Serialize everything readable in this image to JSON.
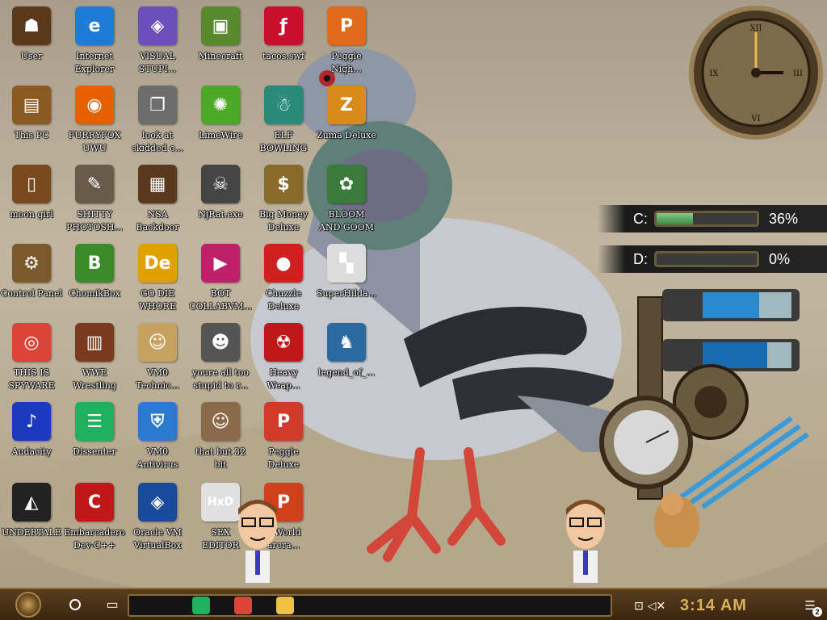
{
  "desktop": {
    "icons": [
      {
        "label": "User",
        "glyph": "☗",
        "color": "#5a3a1c",
        "icon": "user-icon"
      },
      {
        "label": "Internet\nExplorer",
        "glyph": "e",
        "color": "#1e7bd6",
        "icon": "edge-icon"
      },
      {
        "label": "VISUAL\nSTUPI...",
        "glyph": "◈",
        "color": "#6b4fbb",
        "icon": "visual-studio-icon"
      },
      {
        "label": "Minecraft",
        "glyph": "▣",
        "color": "#5b8a2e",
        "icon": "minecraft-icon"
      },
      {
        "label": "tacos.swf",
        "glyph": "ƒ",
        "color": "#c8102e",
        "icon": "flash-file-icon"
      },
      {
        "label": "Peggle\nNigh...",
        "glyph": "P",
        "color": "#e06a1b",
        "icon": "peggle-icon"
      },
      {
        "label": "This PC",
        "glyph": "▤",
        "color": "#8a5a20",
        "icon": "computer-icon"
      },
      {
        "label": "FURRYFOX\nUWU",
        "glyph": "◉",
        "color": "#e66000",
        "icon": "firefox-icon"
      },
      {
        "label": "look at\nskidded c...",
        "glyph": "❐",
        "color": "#6d6d6d",
        "icon": "folder-stack-icon"
      },
      {
        "label": "LimeWire",
        "glyph": "✺",
        "color": "#4ea828",
        "icon": "limewire-icon"
      },
      {
        "label": "ELF\nBOWLING",
        "glyph": "☃",
        "color": "#2a8a7a",
        "icon": "elf-bowling-icon"
      },
      {
        "label": "Zuma Deluxe",
        "glyph": "Z",
        "color": "#d88a1a",
        "icon": "zuma-icon"
      },
      {
        "label": "moon girl",
        "glyph": "▯",
        "color": "#7a4a1e",
        "icon": "file-icon"
      },
      {
        "label": "SHITTY\nPHOTOSH...",
        "glyph": "✎",
        "color": "#6a5a4a",
        "icon": "gimp-icon"
      },
      {
        "label": "NSA\nBackdoor",
        "glyph": "▦",
        "color": "#5a3a1e",
        "icon": "backdoor-icon"
      },
      {
        "label": "NjRat.exe",
        "glyph": "☠",
        "color": "#444444",
        "icon": "skull-icon"
      },
      {
        "label": "Big Money\nDeluxe",
        "glyph": "$",
        "color": "#8a6a2a",
        "icon": "money-bag-icon"
      },
      {
        "label": "BLOOM\nAND GOOM",
        "glyph": "✿",
        "color": "#3a7a3a",
        "icon": "flower-icon"
      },
      {
        "label": "Control Panel",
        "glyph": "⚙",
        "color": "#7a5a2a",
        "icon": "control-panel-icon"
      },
      {
        "label": "ChomikBox",
        "glyph": "B",
        "color": "#3a8a2a",
        "icon": "chomikbox-icon"
      },
      {
        "label": "GO DIE\nWHORE",
        "glyph": "De",
        "color": "#e0a000",
        "icon": "dev-app-icon"
      },
      {
        "label": "BOT\nCOLLABVM...",
        "glyph": "▶",
        "color": "#c0206a",
        "icon": "bot-icon"
      },
      {
        "label": "Chuzzle\nDeluxe",
        "glyph": "●",
        "color": "#d02020",
        "icon": "chuzzle-icon"
      },
      {
        "label": "SuperHilda...",
        "glyph": "▚",
        "color": "#dcdcdc",
        "icon": "pixel-game-icon"
      },
      {
        "label": "THIS IS\nSPYWARE",
        "glyph": "◎",
        "color": "#db4437",
        "icon": "chrome-icon"
      },
      {
        "label": "WWE\nWrestling",
        "glyph": "▥",
        "color": "#7a3a1e",
        "icon": "wrestling-icon"
      },
      {
        "label": "VM0\nTechnic...",
        "glyph": "☺",
        "color": "#c8a060",
        "icon": "technician-icon"
      },
      {
        "label": "youre all too\nstupid to r...",
        "glyph": "☻",
        "color": "#555555",
        "icon": "portrait-icon"
      },
      {
        "label": "Heavy\nWeap...",
        "glyph": "☢",
        "color": "#c01818",
        "icon": "radiation-icon"
      },
      {
        "label": "legend_of_...",
        "glyph": "♞",
        "color": "#2a6aa0",
        "icon": "legend-game-icon"
      },
      {
        "label": "Audacity",
        "glyph": "♪",
        "color": "#1a3ac0",
        "icon": "audacity-icon"
      },
      {
        "label": "Dissenter",
        "glyph": "☰",
        "color": "#20b060",
        "icon": "dissenter-icon"
      },
      {
        "label": "VM0\nAntivirus",
        "glyph": "⛨",
        "color": "#2a7ad0",
        "icon": "shield-icon"
      },
      {
        "label": "that but 32\nbit",
        "glyph": "☺",
        "color": "#8a6a4a",
        "icon": "portrait-icon"
      },
      {
        "label": "Peggle\nDeluxe",
        "glyph": "P",
        "color": "#d03a2a",
        "icon": "peggle-icon"
      },
      {
        "label": "",
        "glyph": "",
        "color": "transparent",
        "icon": "empty-slot"
      },
      {
        "label": "UNDERTALE",
        "glyph": "◭",
        "color": "#222222",
        "icon": "unity-icon"
      },
      {
        "label": "Embarcadero\nDev-C++",
        "glyph": "C",
        "color": "#c01818",
        "icon": "devcpp-icon"
      },
      {
        "label": "Oracle VM\nVirtualBox",
        "glyph": "◈",
        "color": "#1a4a9a",
        "icon": "virtualbox-icon"
      },
      {
        "label": "SEX\nEDITOR",
        "glyph": "HxD",
        "color": "#e0e0e0",
        "icon": "hex-editor-icon"
      },
      {
        "label": "e World\narcra...",
        "glyph": "P",
        "color": "#d0401a",
        "icon": "peggle-world-icon"
      },
      {
        "label": "",
        "glyph": "",
        "color": "transparent",
        "icon": "empty-slot"
      }
    ]
  },
  "widgets": {
    "drives": [
      {
        "label": "C:",
        "percent": 36,
        "text": "36%"
      },
      {
        "label": "D:",
        "percent": 0,
        "text": "0%"
      }
    ]
  },
  "taskbar": {
    "apps": [
      {
        "icon": "dissenter-icon",
        "color": "#20b060"
      },
      {
        "icon": "chrome-icon",
        "color": "#db4437"
      },
      {
        "icon": "file-explorer-icon",
        "color": "#f0c040"
      }
    ],
    "time": "3:14 AM",
    "notification_count": "2"
  }
}
